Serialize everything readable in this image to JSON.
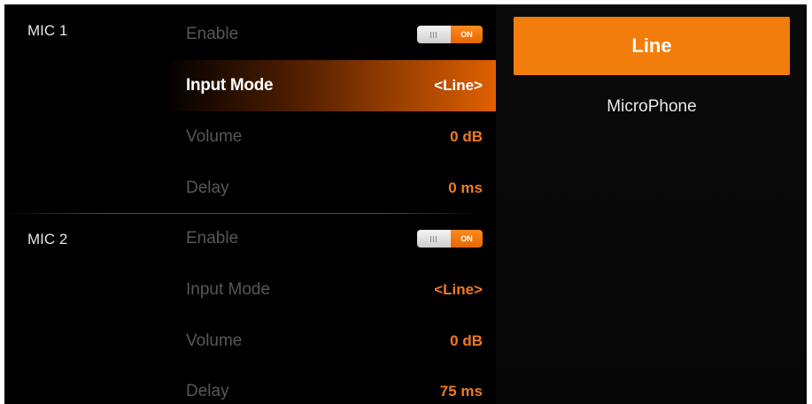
{
  "groups": [
    {
      "name": "MIC 1",
      "rows": {
        "enable": {
          "label": "Enable",
          "toggle": "ON"
        },
        "input_mode": {
          "label": "Input Mode",
          "value": "<Line>"
        },
        "volume": {
          "label": "Volume",
          "value": "0 dB"
        },
        "delay": {
          "label": "Delay",
          "value": "0 ms"
        }
      }
    },
    {
      "name": "MIC 2",
      "rows": {
        "enable": {
          "label": "Enable",
          "toggle": "ON"
        },
        "input_mode": {
          "label": "Input Mode",
          "value": "<Line>"
        },
        "volume": {
          "label": "Volume",
          "value": "0 dB"
        },
        "delay": {
          "label": "Delay",
          "value": "75 ms"
        }
      }
    }
  ],
  "options_panel": {
    "options": [
      "Line",
      "MicroPhone"
    ],
    "selected": "Line"
  },
  "colors": {
    "accent": "#f27d0c",
    "value_text": "#f07a20",
    "dim_label": "#575757",
    "background": "#000000"
  }
}
